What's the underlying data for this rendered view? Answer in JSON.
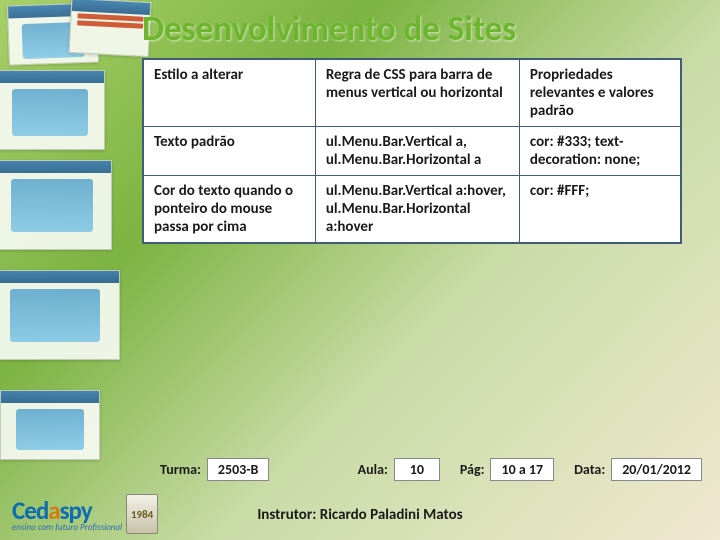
{
  "title": "Desenvolvimento de Sites",
  "table": {
    "headers": {
      "col1": "Estilo a alterar",
      "col2": "Regra de CSS para barra de menus vertical ou horizontal",
      "col3": "Propriedades relevantes e valores padrão"
    },
    "rows": [
      {
        "col1": "Texto padrão",
        "col2": "ul.Menu.Bar.Vertical a, ul.Menu.Bar.Horizontal a",
        "col3": "cor: #333; text-decoration: none;"
      },
      {
        "col1": "Cor do texto quando o ponteiro do mouse passa por cima",
        "col2": "ul.Menu.Bar.Vertical a:hover, ul.Menu.Bar.Horizontal a:hover",
        "col3": "cor: #FFF;"
      }
    ]
  },
  "footer": {
    "turma_label": "Turma:",
    "turma_value": "2503-B",
    "aula_label": "Aula:",
    "aula_value": "10",
    "pag_label": "Pág:",
    "pag_value": "10 a 17",
    "data_label": "Data:",
    "data_value": "20/01/2012"
  },
  "instructor": {
    "label": "Instrutor:",
    "name": "Ricardo Paladini Matos"
  },
  "logo": {
    "brand_c": "Ced",
    "brand_a": "a",
    "brand_spy": "spy",
    "tagline": "ensino com futuro Profissional",
    "badge_year": "1984"
  }
}
